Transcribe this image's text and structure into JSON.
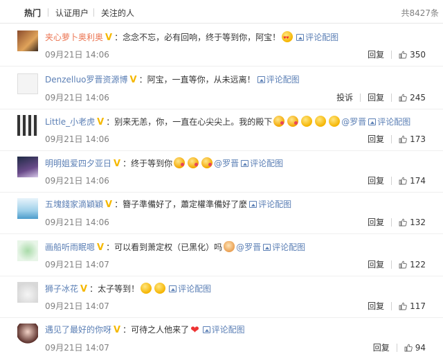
{
  "tabs": [
    {
      "label": "热门",
      "active": true
    },
    {
      "label": "认证用户",
      "active": false
    },
    {
      "label": "关注的人",
      "active": false
    }
  ],
  "total": "共8427条",
  "pic_link_label": "评论配图",
  "reply_label": "回复",
  "report_label": "投诉",
  "comments": [
    {
      "user": "夹心萝卜奥利奥",
      "text": "：念念不忘，必有回响，终于等到你，阿宝！",
      "emoji": [
        "love"
      ],
      "mentions": [],
      "time": "09月21日 14:06",
      "likes": "350",
      "report": false
    },
    {
      "user": "Denzelluo罗晋资源博",
      "text": "：阿宝，一直等你，从未远离！",
      "emoji": [],
      "mentions": [],
      "time": "09月21日 14:06",
      "likes": "245",
      "report": true
    },
    {
      "user": "Little_小老虎",
      "text": "：别来无恙，你，一直在心尖尖上。我的殿下",
      "emoji": [
        "kiss",
        "kiss",
        "yellow",
        "yellow",
        "yellow"
      ],
      "mentions": [
        "@罗晋"
      ],
      "time": "09月21日 14:06",
      "likes": "173",
      "report": false
    },
    {
      "user": "明明姐爱四夕亚日",
      "text": "：终于等到你",
      "emoji": [
        "kiss",
        "kiss",
        "kiss"
      ],
      "mentions": [
        "@罗晋"
      ],
      "time": "09月21日 14:06",
      "likes": "174",
      "report": false
    },
    {
      "user": "五塊錢家滴穎穎",
      "text": "：簪子準備好了，蕭定權準備好了麼",
      "emoji": [],
      "mentions": [],
      "time": "09月21日 14:06",
      "likes": "132",
      "report": false
    },
    {
      "user": "画船听雨眠嗯",
      "text": "：可以看到萧定权（已黑化）吗",
      "emoji": [
        "cat"
      ],
      "mentions": [
        "@罗晋"
      ],
      "time": "09月21日 14:07",
      "likes": "122",
      "report": false
    },
    {
      "user": "狮子冰花",
      "text": "：太子等到！",
      "emoji": [
        "yellow",
        "yellow"
      ],
      "mentions": [],
      "time": "09月21日 14:07",
      "likes": "117",
      "report": false
    },
    {
      "user": "遇见了最好的你呀",
      "text": "：可待之人他来了",
      "emoji": [
        "heart"
      ],
      "mentions": [],
      "time": "09月21日 14:07",
      "likes": "94",
      "report": false
    }
  ],
  "colors": {
    "username": "#eb7350",
    "link": "#5b7fb5",
    "vip_badge": "#f5b800",
    "meta": "#808080"
  }
}
